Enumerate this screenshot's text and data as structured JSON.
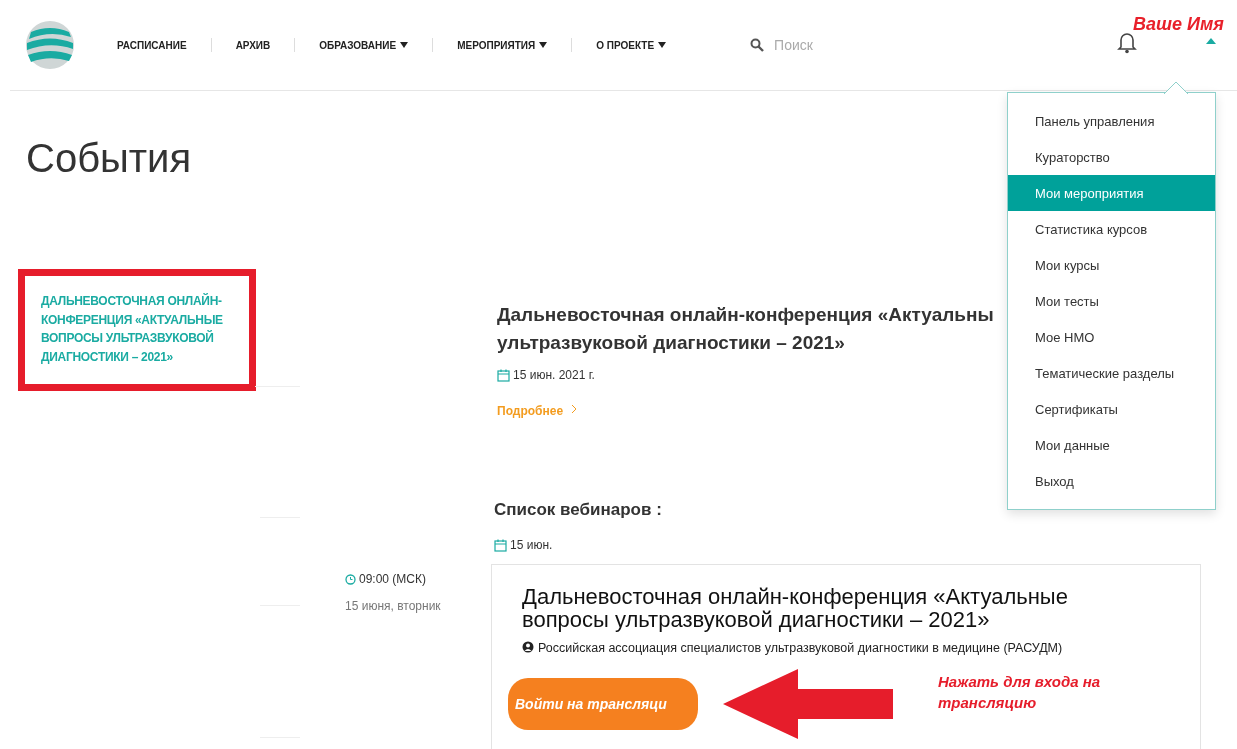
{
  "header": {
    "nav": [
      {
        "label": "РАСПИСАНИЕ",
        "dropdown": false
      },
      {
        "label": "АРХИВ",
        "dropdown": false
      },
      {
        "label": "ОБРАЗОВАНИЕ",
        "dropdown": true
      },
      {
        "label": "МЕРОПРИЯТИЯ",
        "dropdown": true
      },
      {
        "label": "О ПРОЕКТЕ",
        "dropdown": true
      }
    ],
    "search": {
      "placeholder": "Поиск"
    },
    "user_name": "Ваше Имя"
  },
  "user_menu": {
    "open": true,
    "items": [
      {
        "label": "Панель управления",
        "selected": false
      },
      {
        "label": "Кураторство",
        "selected": false
      },
      {
        "label": "Мои мероприятия",
        "selected": true
      },
      {
        "label": "Статистика курсов",
        "selected": false
      },
      {
        "label": "Мои курсы",
        "selected": false
      },
      {
        "label": "Мои тесты",
        "selected": false
      },
      {
        "label": "Мое НМО",
        "selected": false
      },
      {
        "label": "Тематические разделы",
        "selected": false
      },
      {
        "label": "Сертификаты",
        "selected": false
      },
      {
        "label": "Мои данные",
        "selected": false
      },
      {
        "label": "Выход",
        "selected": false
      }
    ]
  },
  "page_title": "События",
  "sidebar": {
    "items": [
      {
        "label": "ДАЛЬНЕВОСТОЧНАЯ ОНЛАЙН-КОНФЕРЕНЦИЯ «АКТУАЛЬНЫЕ ВОПРОСЫ УЛЬТРАЗВУКОВОЙ ДИАГНОСТИКИ – 2021»",
        "framed": true
      }
    ]
  },
  "event": {
    "title_lines": [
      "Дальневосточная онлайн-конференция «Актуальны",
      "ультразвуковой диагностики – 2021»"
    ],
    "date": "15 июн. 2021 г.",
    "more_link": "Подробнее"
  },
  "webinars": {
    "heading": "Список вебинаров :",
    "date": "15 июн.",
    "items": [
      {
        "time": "09:00 (МСК)",
        "day": "15 июня, вторник",
        "title": "Дальневосточная онлайн-конференция «Актуальные вопросы ультразвуковой диагностики – 2021»",
        "organizer": "Российская ассоциация специалистов ультразвуковой диагностики в медицине (РАСУДМ)",
        "button": "Войти на трансляци"
      }
    ]
  },
  "annotation": {
    "text": "Нажать для входа на трансляцию"
  }
}
